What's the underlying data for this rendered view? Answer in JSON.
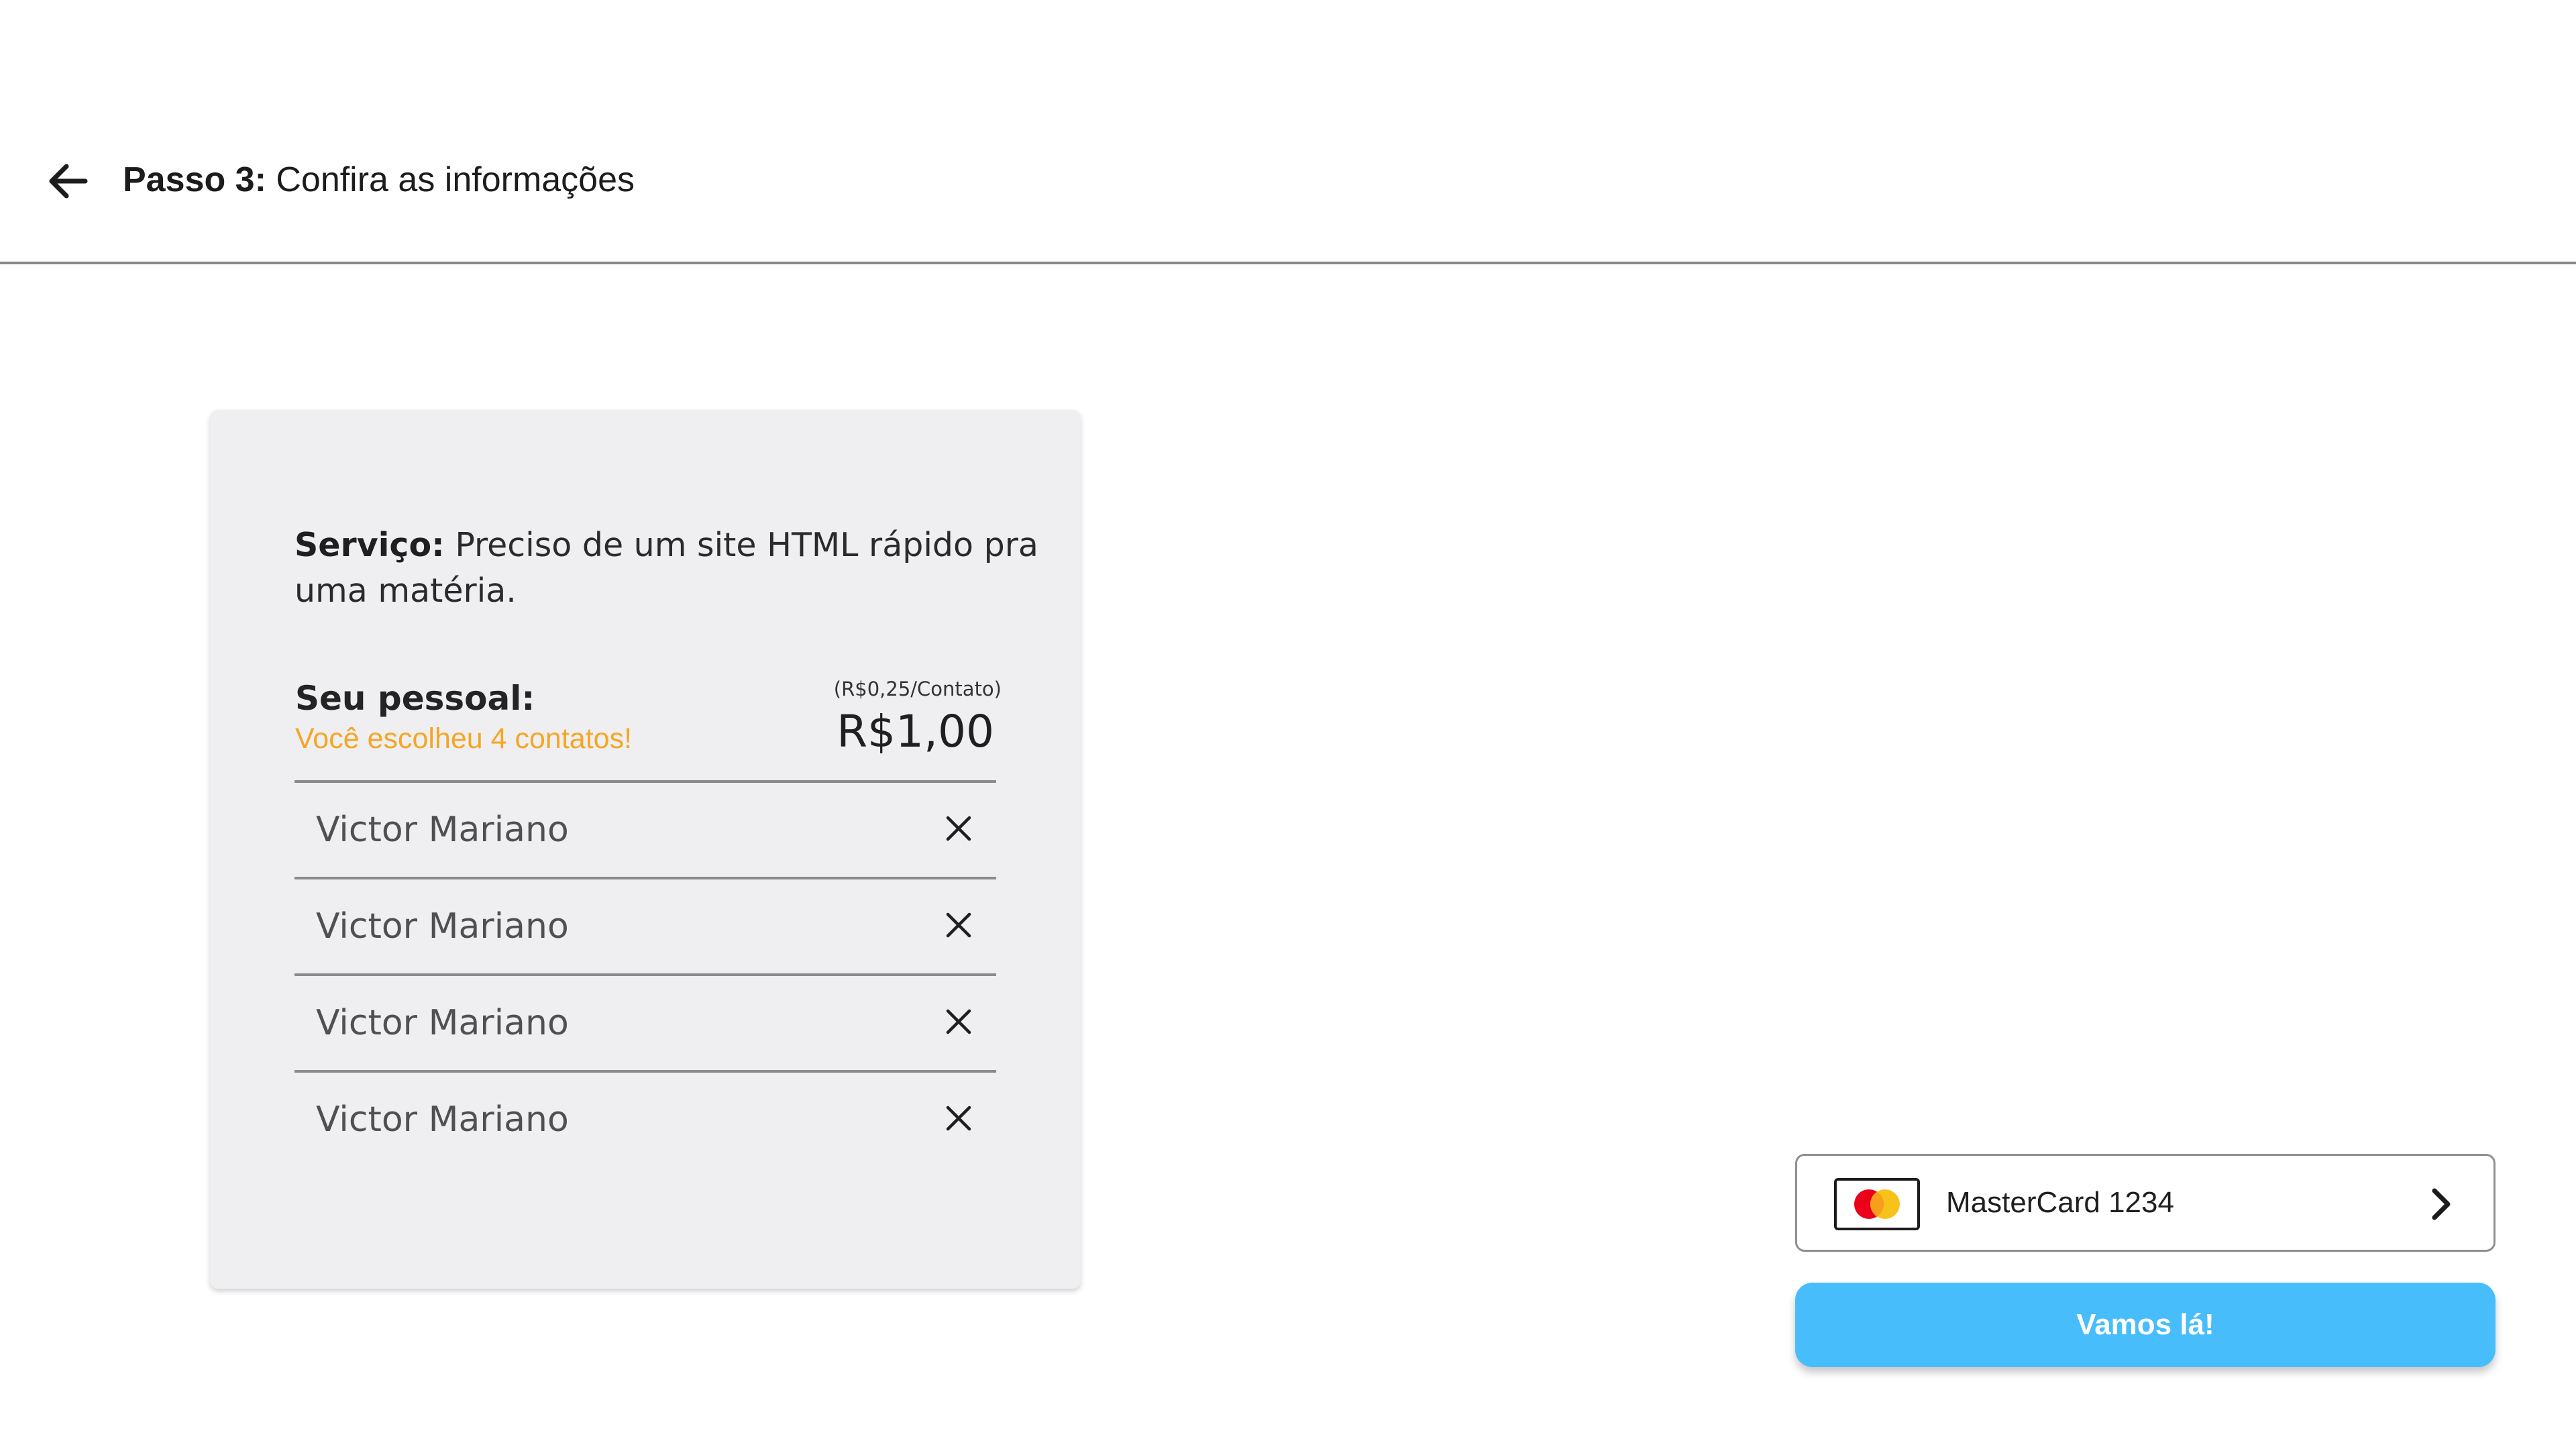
{
  "header": {
    "back_icon": "arrow-left-icon",
    "step": "Passo 3:",
    "title": "Confira as informações"
  },
  "summary": {
    "service_label": "Serviço:",
    "service_text": "Preciso de um site HTML rápido pra uma matéria.",
    "staff_label": "Seu pessoal:",
    "staff_chosen": "Você escolheu 4 contatos!",
    "price_per_contact": "(R$0,25/Contato)",
    "total_price": "R$1,00",
    "contacts": [
      {
        "name": "Victor Mariano",
        "remove_icon": "close-icon"
      },
      {
        "name": "Victor Mariano",
        "remove_icon": "close-icon"
      },
      {
        "name": "Victor Mariano",
        "remove_icon": "close-icon"
      },
      {
        "name": "Victor Mariano",
        "remove_icon": "close-icon"
      }
    ]
  },
  "payment": {
    "card_icon": "mastercard-icon",
    "label": "MasterCard 1234",
    "chevron_icon": "chevron-right-icon"
  },
  "confirm_button": {
    "label": "Vamos lá!"
  },
  "colors": {
    "accent_orange": "#f5a623",
    "confirm_blue": "#48bdfc",
    "card_background": "#efeff2",
    "mastercard_red": "#eb001b",
    "mastercard_yellow": "#f79e1b"
  }
}
